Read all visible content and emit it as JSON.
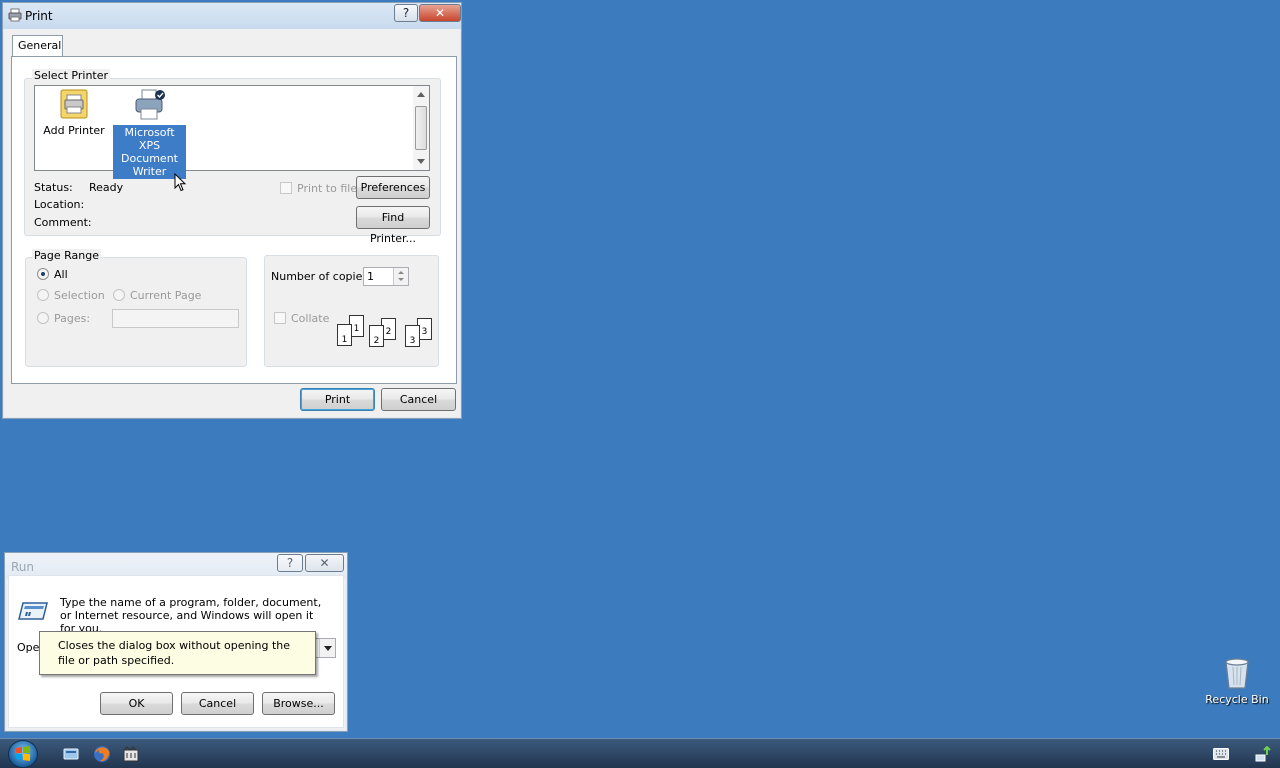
{
  "print_dialog": {
    "title": "Print",
    "help_glyph": "?",
    "close_glyph": "✕",
    "tab_general": "General",
    "select_printer_label": "Select Printer",
    "printers": [
      {
        "name": "Add Printer",
        "icon": "add-printer-icon"
      },
      {
        "name": "Microsoft XPS Document Writer",
        "icon": "printer-icon",
        "selected": true
      }
    ],
    "status_label": "Status:",
    "status_value": "Ready",
    "location_label": "Location:",
    "comment_label": "Comment:",
    "print_to_file": "Print to file",
    "preferences_button": "Preferences",
    "find_printer_button": "Find Printer...",
    "page_range_label": "Page Range",
    "all_option": "All",
    "selection_option": "Selection",
    "current_page_option": "Current Page",
    "pages_option": "Pages:",
    "copies_label": "Number of copies:",
    "copies_value": "1",
    "collate_label": "Collate",
    "collate_digits": [
      "1",
      "1",
      "2",
      "2",
      "3",
      "3"
    ],
    "print_button": "Print",
    "cancel_button": "Cancel"
  },
  "run_dialog": {
    "title": "Run",
    "help_glyph": "?",
    "close_glyph": "✕",
    "description": "Type the name of a program, folder, document, or Internet resource, and Windows will open it for you.",
    "open_label": "Open",
    "tooltip": "Closes the dialog box without opening the file or path specified.",
    "ok_button": "OK",
    "cancel_button": "Cancel",
    "browse_button": "Browse..."
  },
  "desktop": {
    "recycle_bin_label": "Recycle Bin"
  },
  "colors": {
    "desktop_bg": "#3c7bbd",
    "selection": "#3399ff"
  }
}
